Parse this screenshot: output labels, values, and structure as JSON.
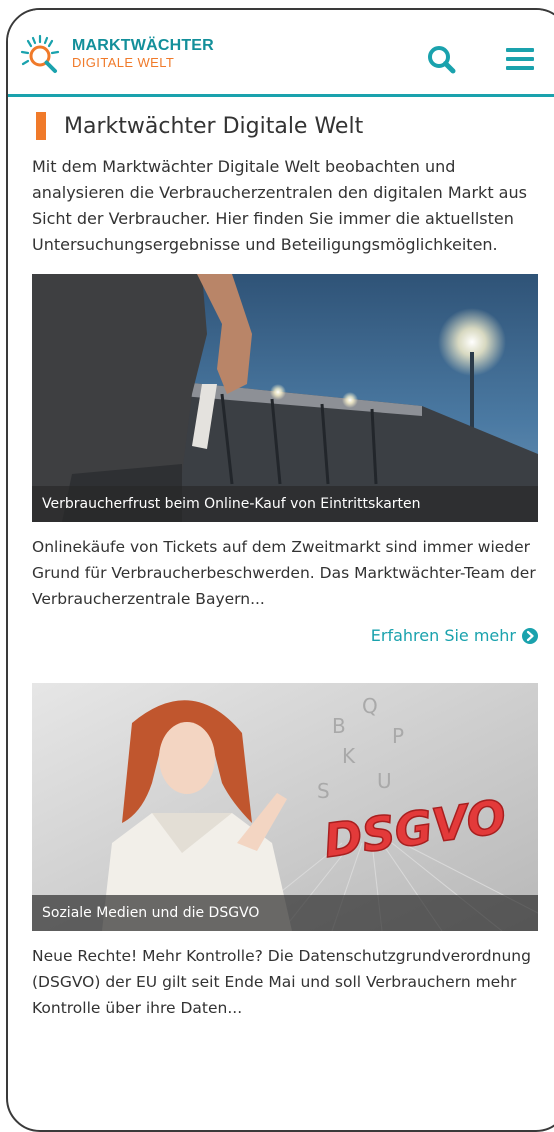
{
  "header": {
    "brand_line1": "MARKTWÄCHTER",
    "brand_line2": "DIGITALE WELT",
    "icons": {
      "logo": "magnifier-sunburst-logo",
      "search": "search-icon",
      "menu": "hamburger-menu-icon"
    }
  },
  "colors": {
    "teal": "#1aa2ad",
    "orange": "#f07a2a",
    "text": "#333333"
  },
  "page": {
    "title": "Marktwächter Digitale Welt",
    "intro": "Mit dem Marktwächter Digitale Welt beobachten und analysieren die Verbraucherzentralen den digitalen Markt aus Sicht der Verbraucher. Hier finden Sie immer die aktuellsten Untersuchungsergebnisse und Beteiligungsmöglichkeiten."
  },
  "articles": [
    {
      "caption": "Verbraucherfrust beim Online-Kauf von Eintrittskarten",
      "teaser": "Onlinekäufe von Tickets auf dem Zweitmarkt sind immer wieder Grund für Verbraucherbeschwerden. Das Marktwächter-Team der Verbraucherzentrale Bayern...",
      "more_label": "Erfahren Sie mehr",
      "more_icon": "arrow-circle-right-icon"
    },
    {
      "caption": "Soziale Medien und die DSGVO",
      "image_text": "DSGVO",
      "teaser": "Neue Rechte! Mehr Kontrolle? Die Datenschutzgrundverordnung (DSGVO) der EU gilt seit Ende Mai und soll Verbrauchern mehr Kontrolle über ihre Daten..."
    }
  ]
}
